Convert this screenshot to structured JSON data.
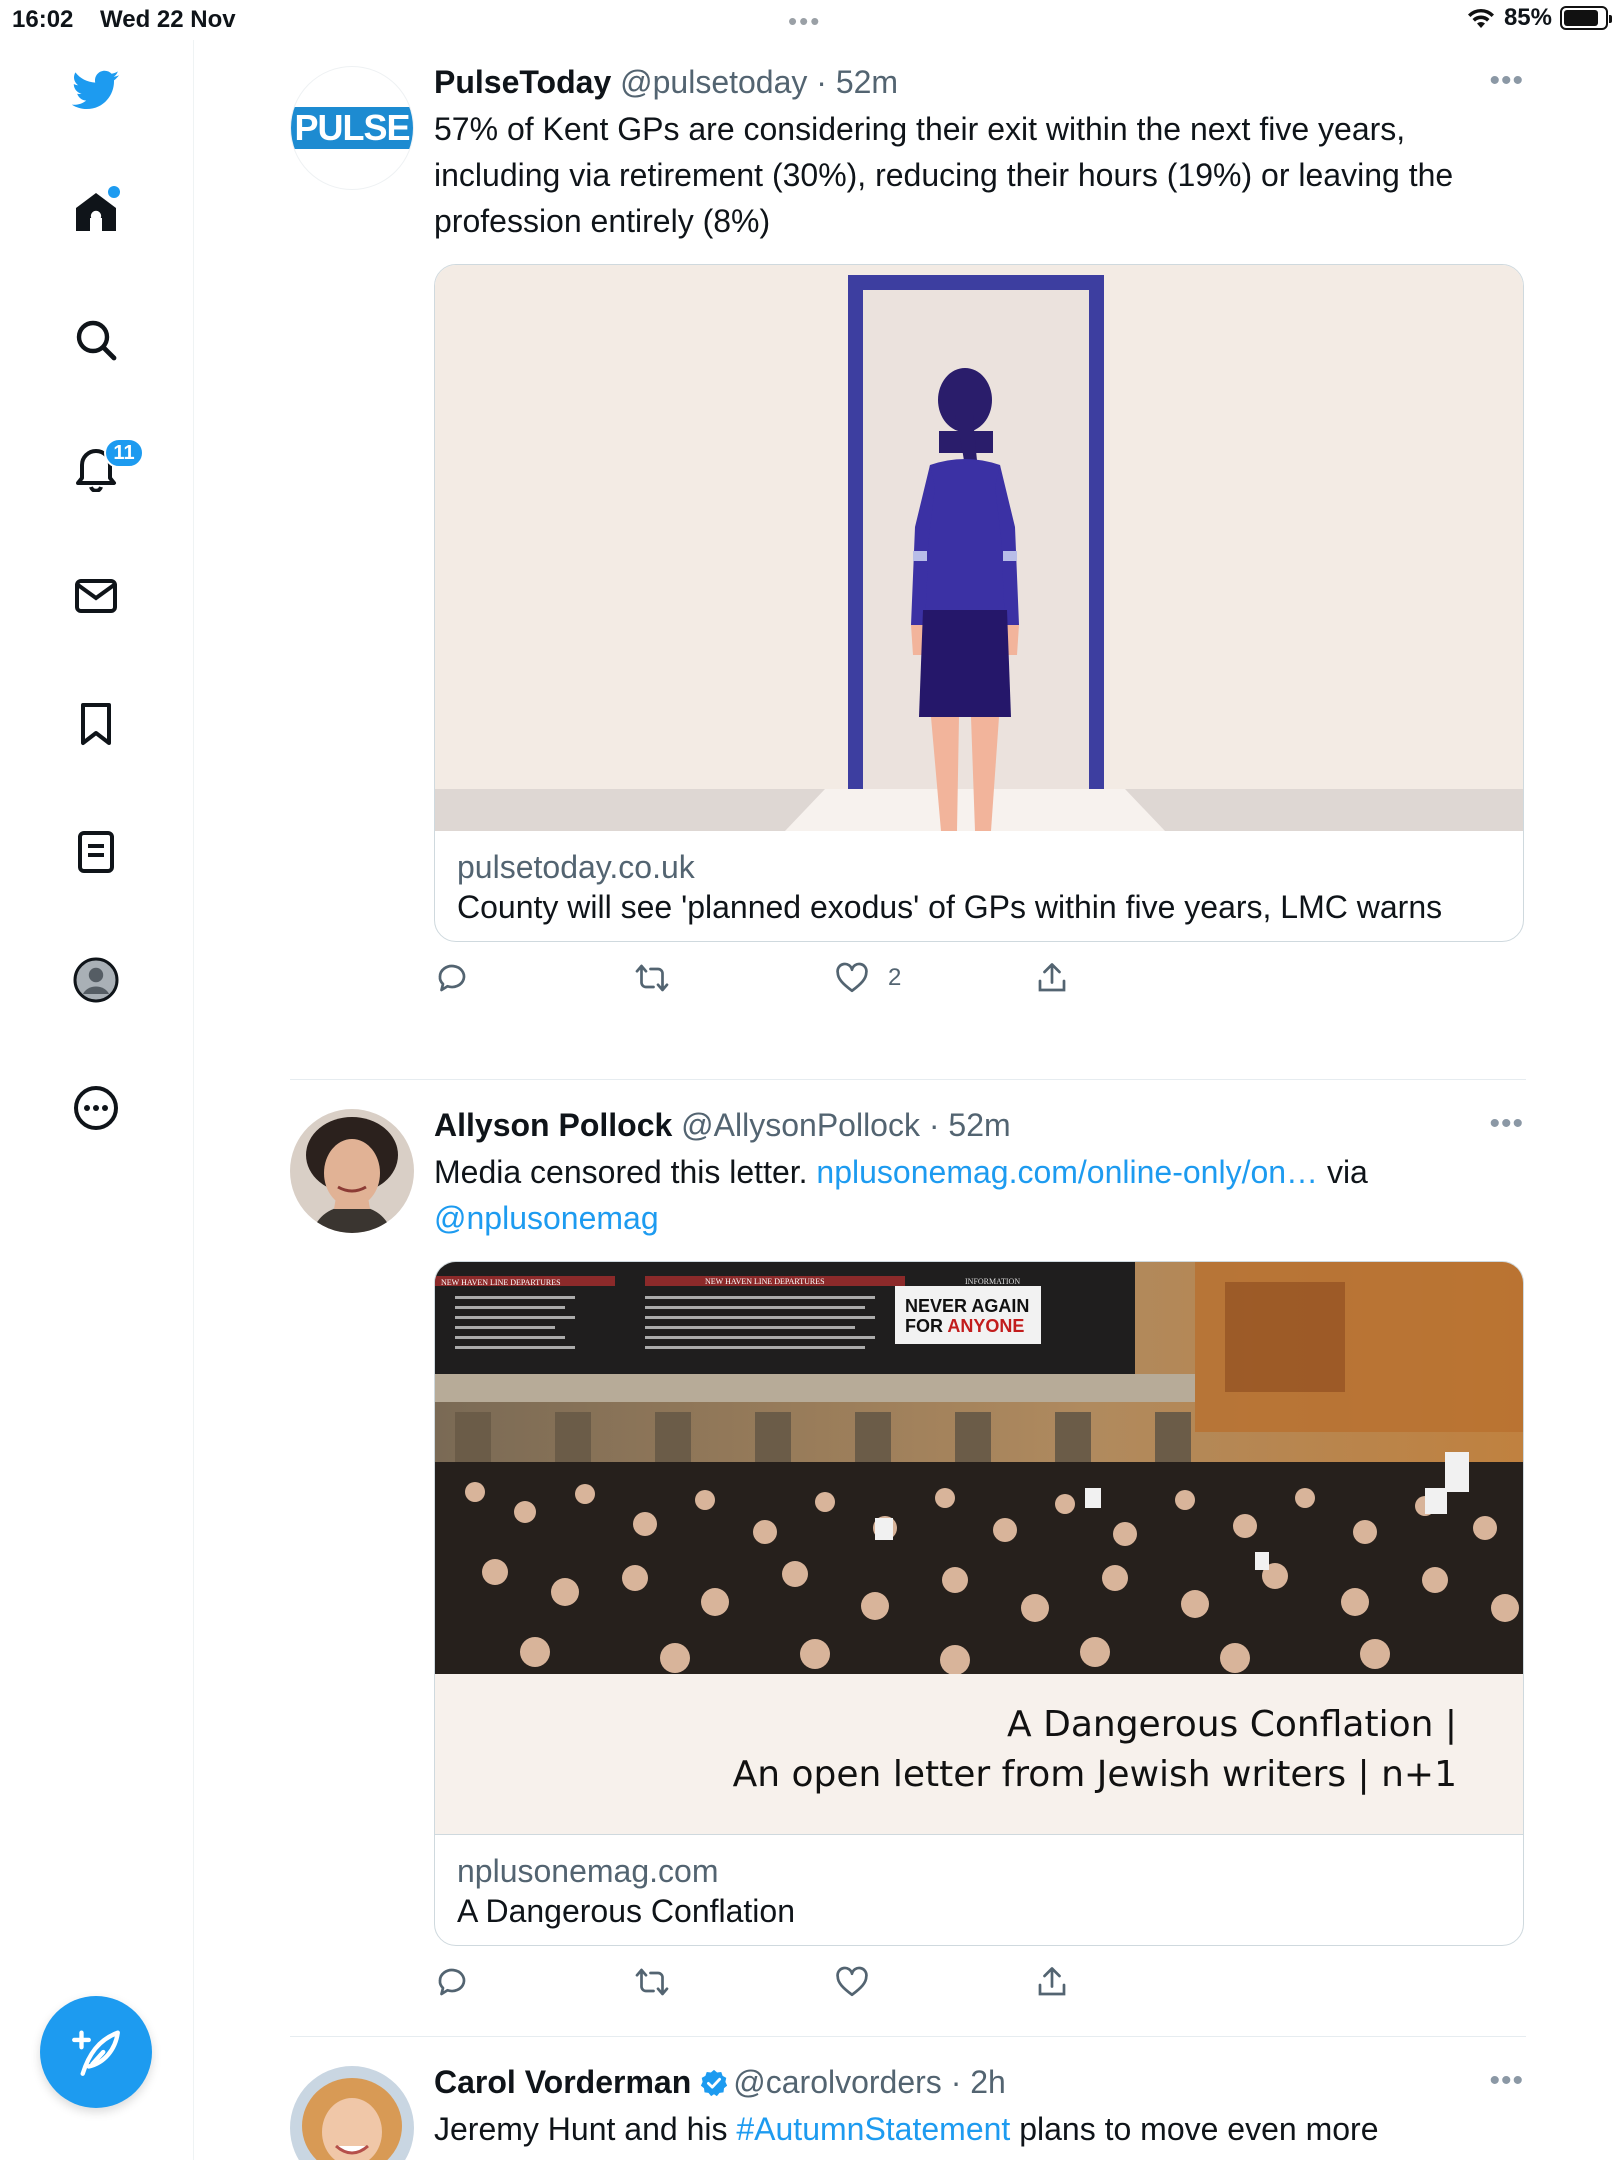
{
  "status_bar": {
    "time": "16:02",
    "date": "Wed 22 Nov",
    "multitask_dots": "•••",
    "battery_text": "85%",
    "battery_level": 0.85
  },
  "sidebar": {
    "items": [
      {
        "name": "twitter-logo-icon"
      },
      {
        "name": "home-icon"
      },
      {
        "name": "search-icon"
      },
      {
        "name": "bell-icon",
        "badge": "11"
      },
      {
        "name": "mail-icon"
      },
      {
        "name": "bookmark-icon"
      },
      {
        "name": "lists-icon"
      },
      {
        "name": "profile-avatar-icon"
      },
      {
        "name": "more-icon"
      }
    ],
    "compose": {
      "name": "compose-tweet-icon"
    }
  },
  "colors": {
    "accent": "#1d9bf0",
    "text": "#0f1419",
    "secondary": "#536471",
    "border": "#cfd9de"
  },
  "tweets": [
    {
      "name": "PulseToday",
      "handle": "@pulsetoday",
      "time": "52m",
      "avatar_text": "PULSE",
      "text": "57% of Kent GPs are considering their exit within the next five years, including via retirement (30%), reducing their hours (19%) or leaving the profession entirely (8%)",
      "card": {
        "domain": "pulsetoday.co.uk",
        "title": "County will see 'planned exodus' of GPs within five years, LMC warns"
      },
      "likes": "2"
    },
    {
      "name": "Allyson Pollock",
      "handle": "@AllysonPollock",
      "time": "52m",
      "text_before": "Media censored this letter. ",
      "text_link": "nplusonemag.com/online-only/on…",
      "text_after": " via ",
      "text_mention": "@nplusonemag",
      "card": {
        "sign_text_1": "NEVER AGAIN",
        "sign_text_2": "FOR ",
        "sign_text_3": "ANYONE",
        "banner_left": "NEW HAVEN LINE DEPARTURES",
        "banner_mid": "NEW HAVEN LINE DEPARTURES",
        "banner_right": "INFORMATION",
        "overlay_line1": "A Dangerous Conflation |",
        "overlay_line2": "An open letter from Jewish writers | n+1",
        "domain": "nplusonemag.com",
        "title": "A Dangerous Conflation"
      }
    },
    {
      "name": "Carol Vorderman",
      "handle": "@carolvorders",
      "time": "2h",
      "verified": true,
      "text_before": "Jeremy Hunt and his ",
      "text_hashtag": "#AutumnStatement",
      "text_after": " plans to move even more"
    }
  ]
}
